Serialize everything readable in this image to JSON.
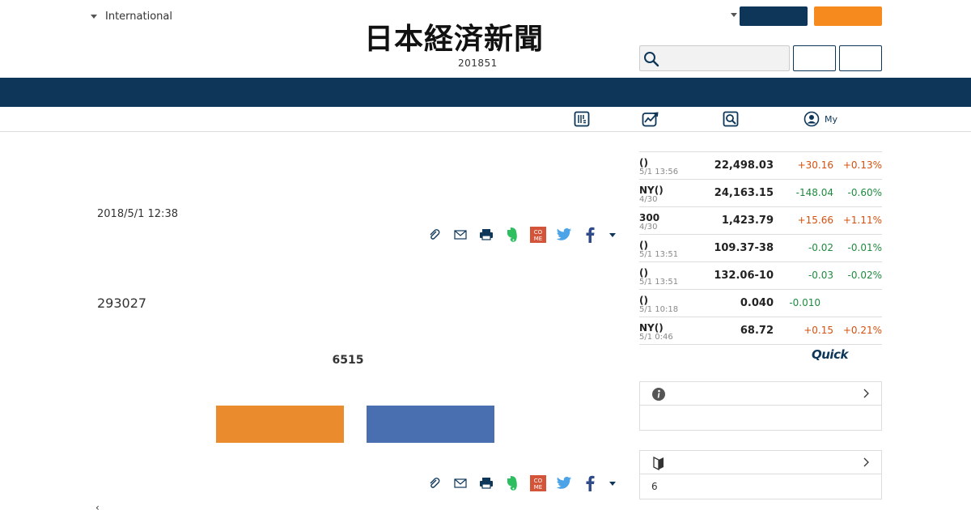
{
  "header": {
    "region_label": "International",
    "logo_text": "日本経済新聞",
    "date_line": "201851",
    "search_placeholder": ""
  },
  "subnav": {
    "my_label": "My"
  },
  "article": {
    "date": "2018/5/1 12:38",
    "body_number": "293027",
    "subheading": "6515",
    "back_label": "‹"
  },
  "colors": {
    "navy": "#0d3659",
    "orange": "#f68a1f",
    "bar_orange": "#ea8c2e",
    "bar_blue": "#4a6fb0",
    "up": "#d4500f",
    "down": "#1f8a3f"
  },
  "market": [
    {
      "name": "()",
      "time": "5/1 13:56",
      "value": "22,498.03",
      "change": "+30.16",
      "pct": "+0.13%",
      "dir": "up"
    },
    {
      "name": "NY()",
      "time": "4/30",
      "value": "24,163.15",
      "change": "-148.04",
      "pct": "-0.60%",
      "dir": "down"
    },
    {
      "name": "300",
      "time": "4/30",
      "value": "1,423.79",
      "change": "+15.66",
      "pct": "+1.11%",
      "dir": "up"
    },
    {
      "name": "()",
      "time": "5/1 13:51",
      "value": "109.37-38",
      "change": "-0.02",
      "pct": "-0.01%",
      "dir": "down"
    },
    {
      "name": "()",
      "time": "5/1 13:51",
      "value": "132.06-10",
      "change": "-0.03",
      "pct": "-0.02%",
      "dir": "down"
    },
    {
      "name": "()",
      "time": "5/1 10:18",
      "value": "0.040",
      "change": "-0.010",
      "pct": "",
      "dir": "down"
    },
    {
      "name": "NY()",
      "time": "5/1 0:46",
      "value": "68.72",
      "change": "+0.15",
      "pct": "+0.21%",
      "dir": "up"
    }
  ],
  "quick_logo": "Quick",
  "sidebar_boxes": [
    {
      "content": ""
    },
    {
      "content": "6"
    }
  ],
  "icons": {
    "share": [
      "paperclip-icon",
      "mail-icon",
      "print-icon",
      "evernote-icon",
      "come-icon",
      "twitter-icon",
      "facebook-icon",
      "more-caret-icon"
    ],
    "subnav": [
      "newspaper-icon",
      "chart-icon",
      "search-icon",
      "user-icon"
    ]
  }
}
